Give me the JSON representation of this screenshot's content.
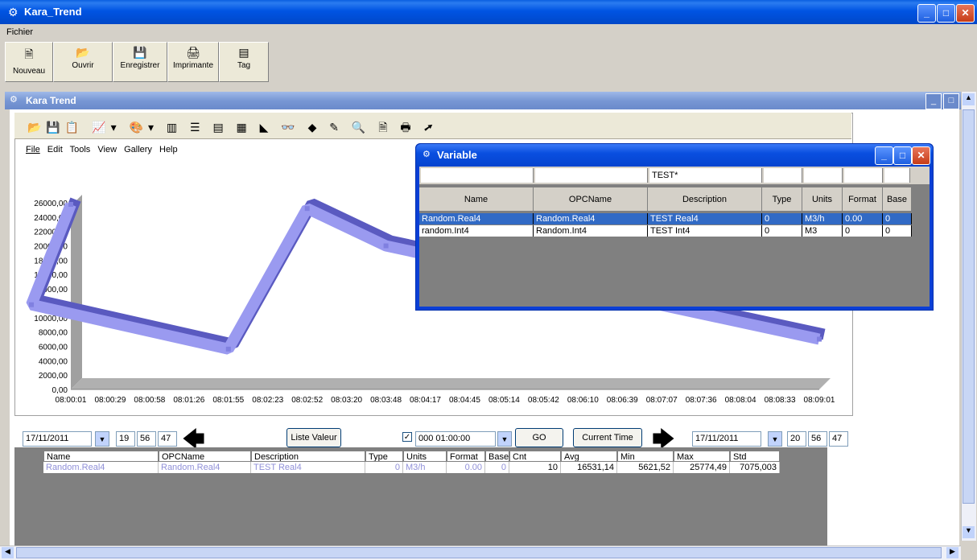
{
  "window": {
    "title": "Kara_Trend"
  },
  "menu": [
    "Fichier"
  ],
  "toolbar": [
    {
      "label": "Nouveau",
      "icon": "new-icon"
    },
    {
      "label": "Ouvrir",
      "icon": "open-icon"
    },
    {
      "label": "Enregistrer",
      "icon": "save-icon"
    },
    {
      "label": "Imprimante",
      "icon": "print-icon"
    },
    {
      "label": "Tag",
      "icon": "tag-icon"
    }
  ],
  "child_window": {
    "title": "Kara Trend"
  },
  "chart_menu": [
    "File",
    "Edit",
    "Tools",
    "View",
    "Gallery",
    "Help"
  ],
  "chart_data": {
    "type": "line",
    "y_ticks": [
      "26000,00",
      "24000,00",
      "22000,00",
      "20000,00",
      "18000,00",
      "16000,00",
      "14000,00",
      "12000,00",
      "10000,00",
      "8000,00",
      "6000,00",
      "4000,00",
      "2000,00",
      "0,00"
    ],
    "x_ticks": [
      "08:00:01",
      "08:00:29",
      "08:00:58",
      "08:01:26",
      "08:01:55",
      "08:02:23",
      "08:02:52",
      "08:03:20",
      "08:03:48",
      "08:04:17",
      "08:04:45",
      "08:05:14",
      "08:05:42",
      "08:06:10",
      "08:06:39",
      "08:07:07",
      "08:07:36",
      "08:08:04",
      "08:08:33",
      "08:09:01"
    ],
    "ylim": [
      0,
      26000
    ],
    "series": [
      {
        "x": [
          "08:00:01",
          "08:01:00",
          "08:01:55",
          "08:02:52",
          "08:03:48",
          "08:09:01"
        ],
        "values": [
          25774.49,
          11800,
          5621.52,
          25200,
          20000,
          7000
        ]
      }
    ]
  },
  "controls": {
    "start_date": "17/11/2011",
    "start_h": "19",
    "start_m": "56",
    "start_s": "47",
    "liste_valeur": "Liste Valeur",
    "duration": "000 01:00:00",
    "go": "GO",
    "current_time": "Current Time",
    "end_date": "17/11/2011",
    "end_h": "20",
    "end_m": "56",
    "end_s": "47"
  },
  "stats_table": {
    "headers": [
      "Name",
      "OPCName",
      "Description",
      "Type",
      "Units",
      "Format",
      "Base",
      "Cnt",
      "Avg",
      "Min",
      "Max",
      "Std"
    ],
    "rows": [
      [
        "Random.Real4",
        "Random.Real4",
        "TEST Real4",
        "0",
        "M3/h",
        "0.00",
        "0",
        "10",
        "16531,14",
        "5621,52",
        "25774,49",
        "7075,003"
      ]
    ]
  },
  "variable_window": {
    "title": "Variable",
    "filter": [
      "",
      "",
      "TEST*",
      "",
      "",
      "",
      ""
    ],
    "headers": [
      "Name",
      "OPCName",
      "Description",
      "Type",
      "Units",
      "Format",
      "Base"
    ],
    "rows": [
      [
        "Random.Real4",
        "Random.Real4",
        "TEST Real4",
        "0",
        "M3/h",
        "0.00",
        "0"
      ],
      [
        "random.Int4",
        "Random.Int4",
        "TEST Int4",
        "0",
        "M3",
        "0",
        "0"
      ]
    ]
  }
}
